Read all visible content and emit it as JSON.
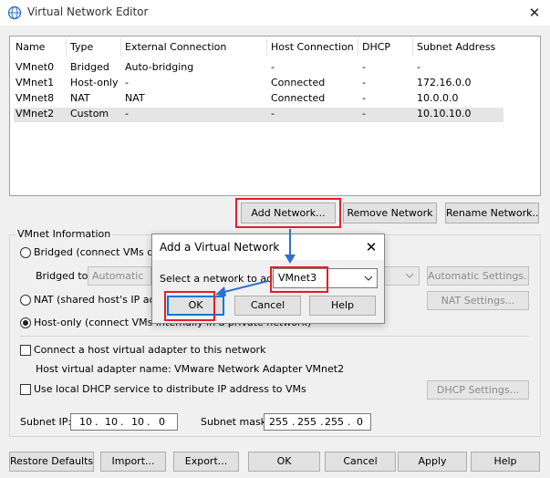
{
  "window": {
    "title": "Virtual Network Editor",
    "close_icon": "close-icon",
    "app_icon": "globe-icon"
  },
  "table": {
    "headers": [
      "Name",
      "Type",
      "External Connection",
      "Host Connection",
      "DHCP",
      "Subnet Address"
    ],
    "rows": [
      [
        "VMnet0",
        "Bridged",
        "Auto-bridging",
        "-",
        "-",
        "-"
      ],
      [
        "VMnet1",
        "Host-only",
        "-",
        "Connected",
        "-",
        "172.16.0.0"
      ],
      [
        "VMnet8",
        "NAT",
        "NAT",
        "Connected",
        "-",
        "10.0.0.0"
      ],
      [
        "VMnet2",
        "Custom",
        "-",
        "-",
        "-",
        "10.10.10.0"
      ]
    ],
    "selected_row": 3
  },
  "list_buttons": {
    "add": "Add Network...",
    "remove": "Remove Network",
    "rename": "Rename Network..."
  },
  "vmnet_info": {
    "title": "VMnet Information",
    "bridged_label": "Bridged (connect VMs direc",
    "bridged_to_label": "Bridged to:",
    "bridged_to_value": "Automatic",
    "auto_settings": "Automatic Settings...",
    "nat_label": "NAT (shared host's IP addr",
    "nat_settings": "NAT Settings...",
    "hostonly_label": "Host-only (connect VMs internally in a private network)",
    "connect_adapter_label": "Connect a host virtual adapter to this network",
    "adapter_name_label": "Host virtual adapter name: VMware Network Adapter VMnet2",
    "dhcp_label": "Use local DHCP service to distribute IP address to VMs",
    "dhcp_settings": "DHCP Settings...",
    "subnet_ip_label": "Subnet IP:",
    "subnet_ip": [
      "10",
      "10",
      "10",
      "0"
    ],
    "subnet_mask_label": "Subnet mask:",
    "subnet_mask": [
      "255",
      "255",
      "255",
      "0"
    ]
  },
  "bottom_buttons": {
    "restore": "Restore Defaults",
    "import": "Import...",
    "export": "Export...",
    "ok": "OK",
    "cancel": "Cancel",
    "apply": "Apply",
    "help": "Help"
  },
  "dialog": {
    "title": "Add a Virtual Network",
    "select_label": "Select a network to add:",
    "selected_network": "VMnet3",
    "ok": "OK",
    "cancel": "Cancel",
    "help": "Help"
  },
  "colors": {
    "highlight_red": "#e0202a",
    "arrow_blue": "#2e6fd1",
    "selected_row": "#e5e5e5"
  }
}
